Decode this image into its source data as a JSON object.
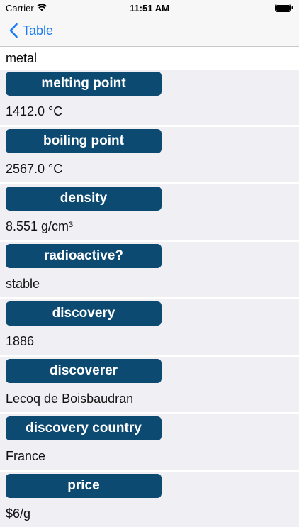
{
  "status": {
    "carrier": "Carrier",
    "time": "11:51 AM"
  },
  "nav": {
    "back_label": "Table"
  },
  "category_value": "metal",
  "properties": [
    {
      "label": "melting point",
      "value": "1412.0 °C"
    },
    {
      "label": "boiling point",
      "value": "2567.0 °C"
    },
    {
      "label": "density",
      "value": "8.551 g/cm³"
    },
    {
      "label": "radioactive?",
      "value": "stable"
    },
    {
      "label": "discovery",
      "value": "1886"
    },
    {
      "label": "discoverer",
      "value": "Lecoq de Boisbaudran"
    },
    {
      "label": "discovery country",
      "value": "France"
    },
    {
      "label": "price",
      "value": "$6/g"
    }
  ],
  "colors": {
    "badge": "#0c4a72",
    "accent": "#1a7cf5",
    "section_bg": "#efeff4"
  }
}
